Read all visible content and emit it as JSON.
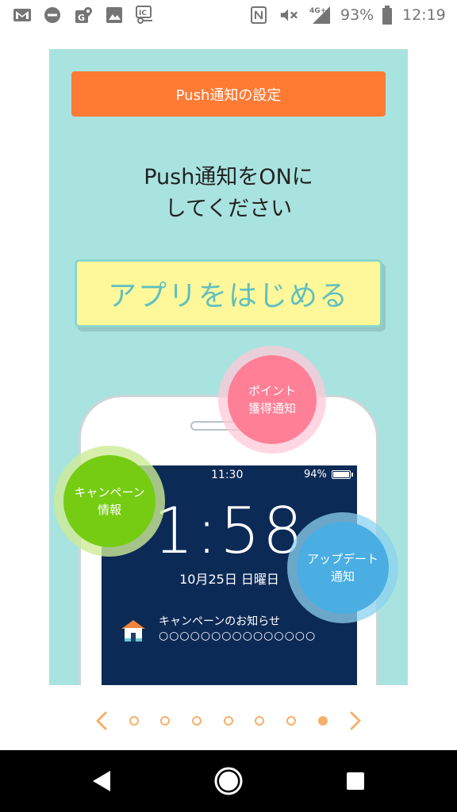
{
  "status_bar": {
    "battery_percent": "93%",
    "time": "12:19",
    "network": "4G+"
  },
  "slide": {
    "header": "Push通知の設定",
    "heading_line1": "Push通知をONに",
    "heading_line2": "してください",
    "start_button": "アプリをはじめる",
    "phone": {
      "status_time": "11:30",
      "battery": "94%",
      "clock": "1:58",
      "date": "10月25日 日曜日",
      "notification_title": "キャンペーンのお知らせ",
      "notification_body": "○○○○○○○○○○○○○○○"
    },
    "bubbles": {
      "point_line1": "ポイント",
      "point_line2": "獲得通知",
      "campaign_line1": "キャンペーン",
      "campaign_line2": "情報",
      "update_line1": "アップデート",
      "update_line2": "通知"
    }
  },
  "pager": {
    "total": 7,
    "active_index": 6
  },
  "colors": {
    "slide_bg": "#a9e3e0",
    "header_bg": "#ff7a33",
    "button_bg": "#fff89a",
    "button_text": "#5fc0c0",
    "screen_bg": "#0c2a56",
    "point_bubble": "#ff7f96",
    "campaign_bubble": "#76cc12",
    "update_bubble": "#4aaee3",
    "pager": "#f6b06b"
  }
}
